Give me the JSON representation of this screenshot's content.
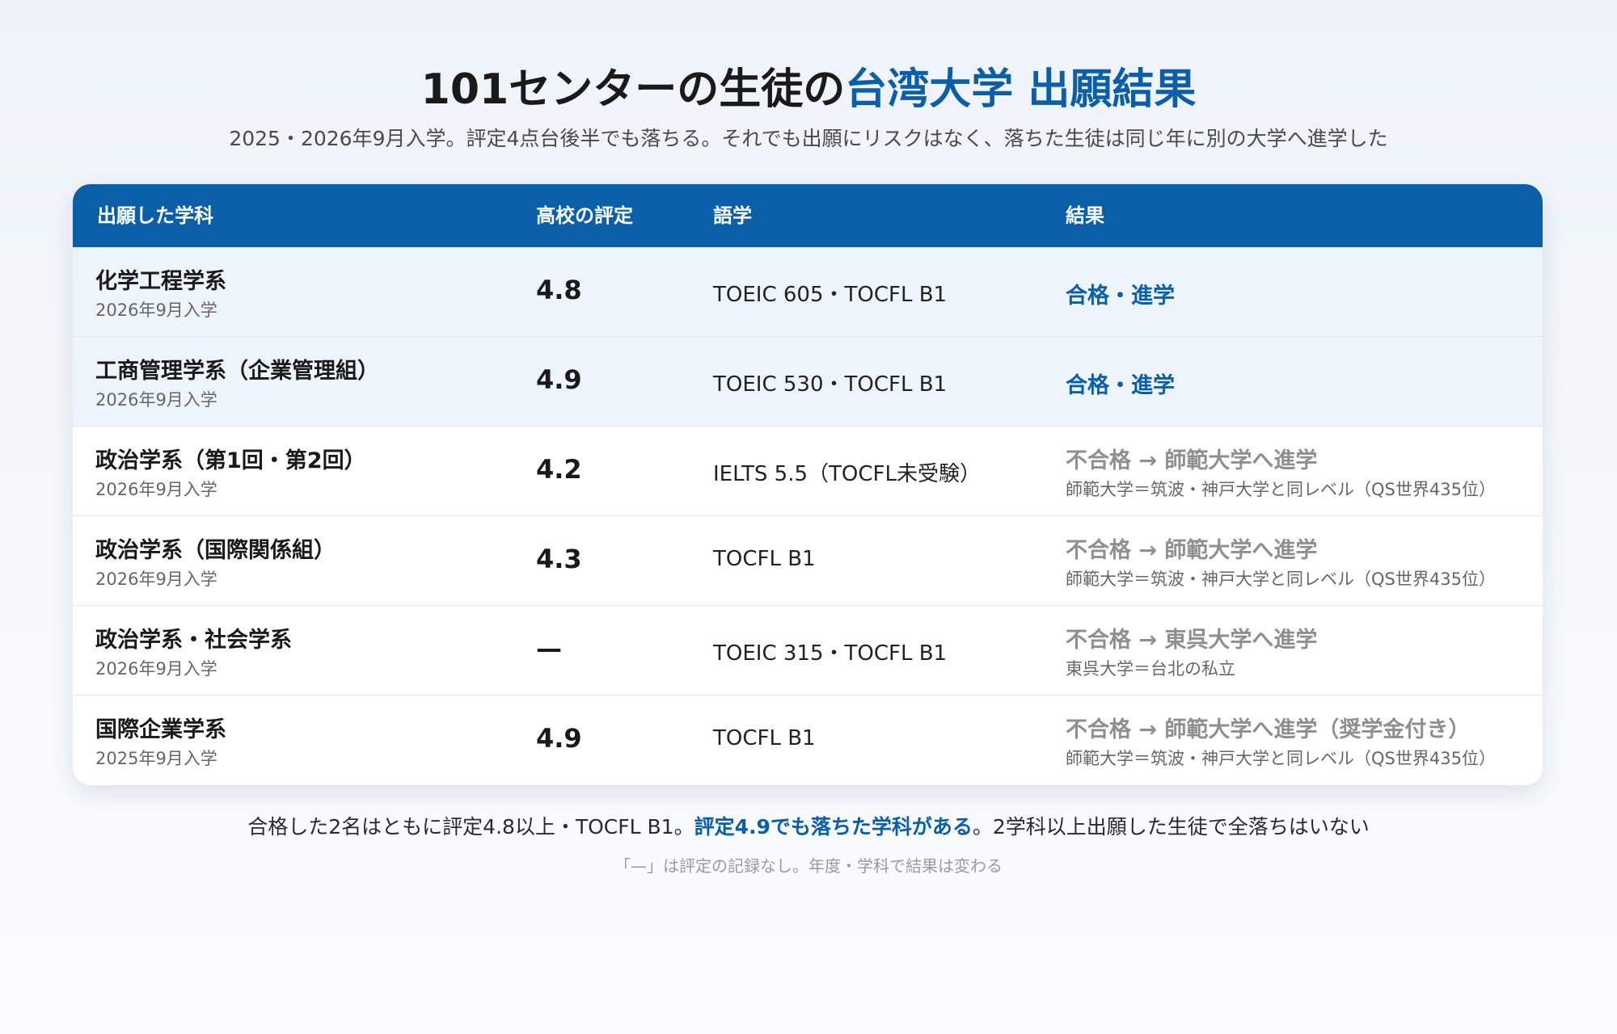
{
  "title": {
    "prefix": "101センターの生徒の",
    "accent": "台湾大学 出願結果"
  },
  "subtitle": "2025・2026年9月入学。評定4点台後半でも落ちる。それでも出願にリスクはなく、落ちた生徒は同じ年に別の大学へ進学した",
  "table": {
    "headers": {
      "department": "出願した学科",
      "grade": "高校の評定",
      "language": "語学",
      "result": "結果"
    },
    "rows": [
      {
        "department": "化学工程学系",
        "year": "2026年9月入学",
        "grade": "4.8",
        "language": "TOEIC 605・TOCFL B1",
        "result": "合格・進学",
        "note": "",
        "status": "pass"
      },
      {
        "department": "工商管理学系（企業管理組）",
        "year": "2026年9月入学",
        "grade": "4.9",
        "language": "TOEIC 530・TOCFL B1",
        "result": "合格・進学",
        "note": "",
        "status": "pass"
      },
      {
        "department": "政治学系（第1回・第2回）",
        "year": "2026年9月入学",
        "grade": "4.2",
        "language": "IELTS 5.5（TOCFL未受験）",
        "result": "不合格 → 師範大学へ進学",
        "note": "師範大学＝筑波・神戸大学と同レベル（QS世界435位）",
        "status": "fail"
      },
      {
        "department": "政治学系（国際関係組）",
        "year": "2026年9月入学",
        "grade": "4.3",
        "language": "TOCFL B1",
        "result": "不合格 → 師範大学へ進学",
        "note": "師範大学＝筑波・神戸大学と同レベル（QS世界435位）",
        "status": "fail"
      },
      {
        "department": "政治学系・社会学系",
        "year": "2026年9月入学",
        "grade": "—",
        "language": "TOEIC 315・TOCFL B1",
        "result": "不合格 → 東呉大学へ進学",
        "note": "東呉大学＝台北の私立",
        "status": "fail"
      },
      {
        "department": "国際企業学系",
        "year": "2025年9月入学",
        "grade": "4.9",
        "language": "TOCFL B1",
        "result": "不合格 → 師範大学へ進学（奨学金付き）",
        "note": "師範大学＝筑波・神戸大学と同レベル（QS世界435位）",
        "status": "fail"
      }
    ]
  },
  "footer": {
    "part1": "合格した2名はともに評定4.8以上・TOCFL B1。",
    "highlight": "評定4.9でも落ちた学科がある",
    "part2": "。2学科以上出願した生徒で全落ちはいない",
    "note": "「—」は評定の記録なし。年度・学科で結果は変わる"
  },
  "colors": {
    "accent": "#0b5fa8",
    "header_bg": "#0b5fa8",
    "pass_row_bg": "#eef4fb",
    "fail_text": "#8f8f8f"
  }
}
